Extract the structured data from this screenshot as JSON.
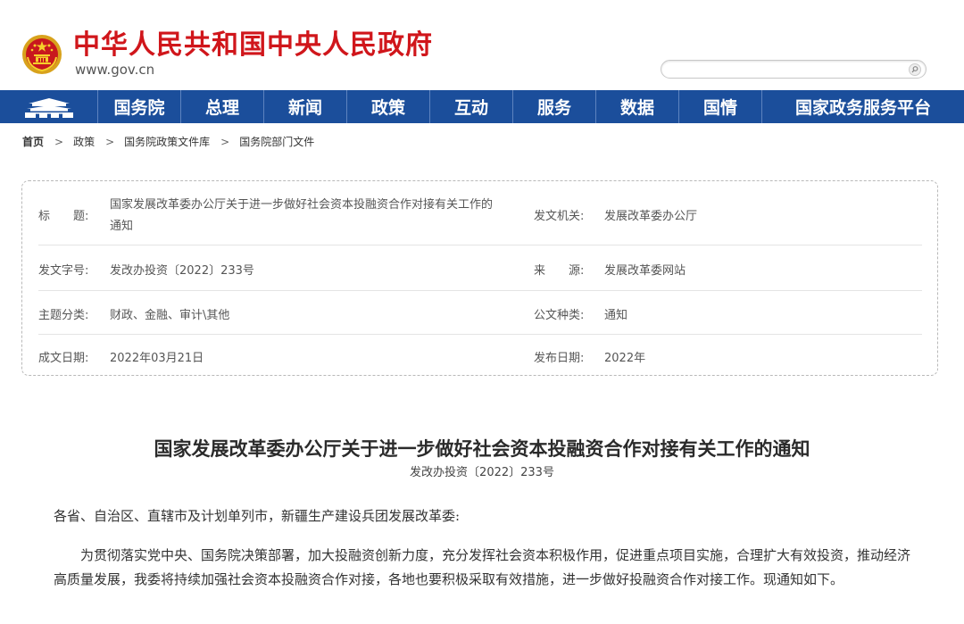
{
  "header": {
    "site_title": "中华人民共和国中央人民政府",
    "site_url": "www.gov.cn",
    "search": {
      "placeholder": ""
    }
  },
  "nav": {
    "items": [
      "国务院",
      "总理",
      "新闻",
      "政策",
      "互动",
      "服务",
      "数据",
      "国情",
      "国家政务服务平台"
    ]
  },
  "breadcrumb": [
    "首页",
    "政策",
    "国务院政策文件库",
    "国务院部门文件"
  ],
  "breadcrumb_sep": ">",
  "info": {
    "title_label": "标　　题:",
    "title_value_line1": "国家发展改革委办公厅关于进一步做好社会资本投融资合作对接有关工作的",
    "title_value_line2": "通知",
    "issuer_label": "发文机关:",
    "issuer_value": "发展改革委办公厅",
    "docno_label": "发文字号:",
    "docno_value": "发改办投资〔2022〕233号",
    "source_label": "来　　源:",
    "source_value": "发展改革委网站",
    "topic_label": "主题分类:",
    "topic_value": "财政、金融、审计\\其他",
    "doctype_label": "公文种类:",
    "doctype_value": "通知",
    "written_label": "成文日期:",
    "written_value": "2022年03月21日",
    "published_label": "发布日期:",
    "published_value": "2022年"
  },
  "article": {
    "title": "国家发展改革委办公厅关于进一步做好社会资本投融资合作对接有关工作的通知",
    "doc_number": "发改办投资〔2022〕233号",
    "greeting": "各省、自治区、直辖市及计划单列市，新疆生产建设兵团发展改革委:",
    "paragraph1": "为贯彻落实党中央、国务院决策部署，加大投融资创新力度，充分发挥社会资本积极作用，促进重点项目实施，合理扩大有效投资，推动经济高质量发展，我委将持续加强社会资本投融资合作对接，各地也要积极采取有效措施，进一步做好投融资合作对接工作。现通知如下。"
  },
  "colors": {
    "brand_red": "#d0161b",
    "nav_blue": "#1b4e9b"
  }
}
